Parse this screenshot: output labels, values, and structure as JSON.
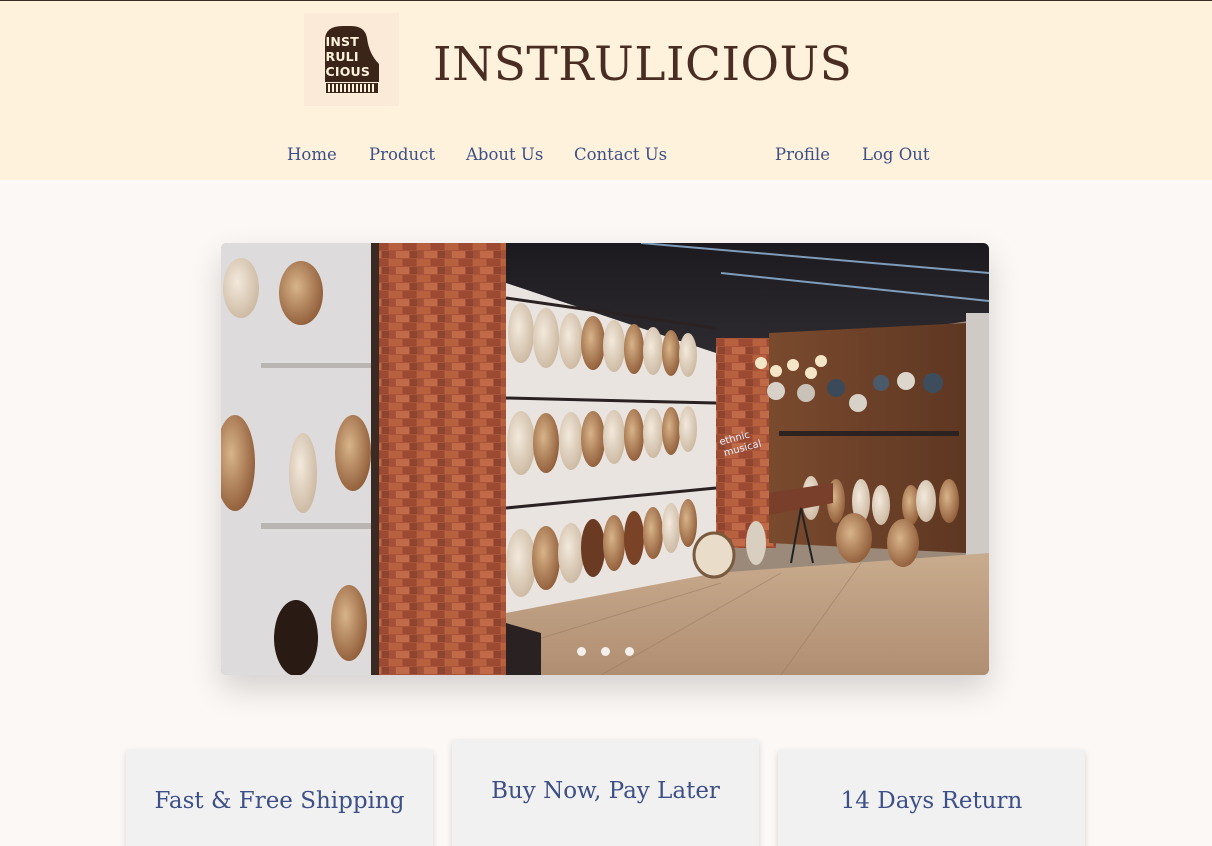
{
  "brand": {
    "name": "INSTRULICIOUS",
    "logo_text": "INST\nRULI\nCIOUS"
  },
  "nav": {
    "home": "Home",
    "product": "Product",
    "about": "About Us",
    "contact": "Contact Us",
    "profile": "Profile",
    "logout": "Log Out"
  },
  "hero": {
    "image": "music-store-interior-photo",
    "slide_count": 3
  },
  "features": [
    {
      "label": "Fast & Free Shipping"
    },
    {
      "label": "Buy Now, Pay Later"
    },
    {
      "label": "14 Days Return"
    }
  ],
  "colors": {
    "header_bg": "#fff2dc",
    "page_bg": "#fcf8f6",
    "brand": "#4a2d22",
    "link": "#3c4f86",
    "card_bg": "#f2f1f2"
  }
}
